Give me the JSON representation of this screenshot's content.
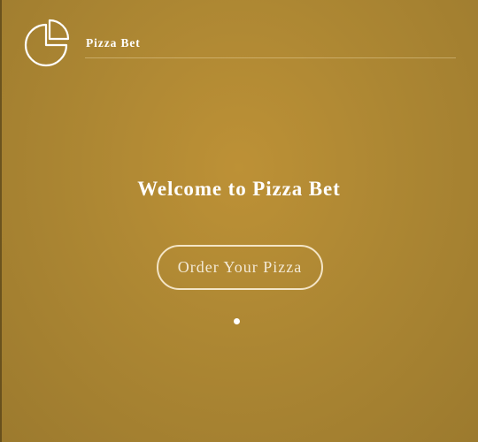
{
  "header": {
    "brand": "Pizza Bet",
    "logo_icon": "pizza-slice-chart-icon"
  },
  "hero": {
    "title": "Welcome to Pizza Bet",
    "cta_label": "Order Your Pizza"
  },
  "carousel": {
    "dot_count": 1,
    "active_index": 0
  },
  "colors": {
    "background": "#ad8733",
    "text": "#ffffff",
    "button_border": "#fff5e1"
  }
}
